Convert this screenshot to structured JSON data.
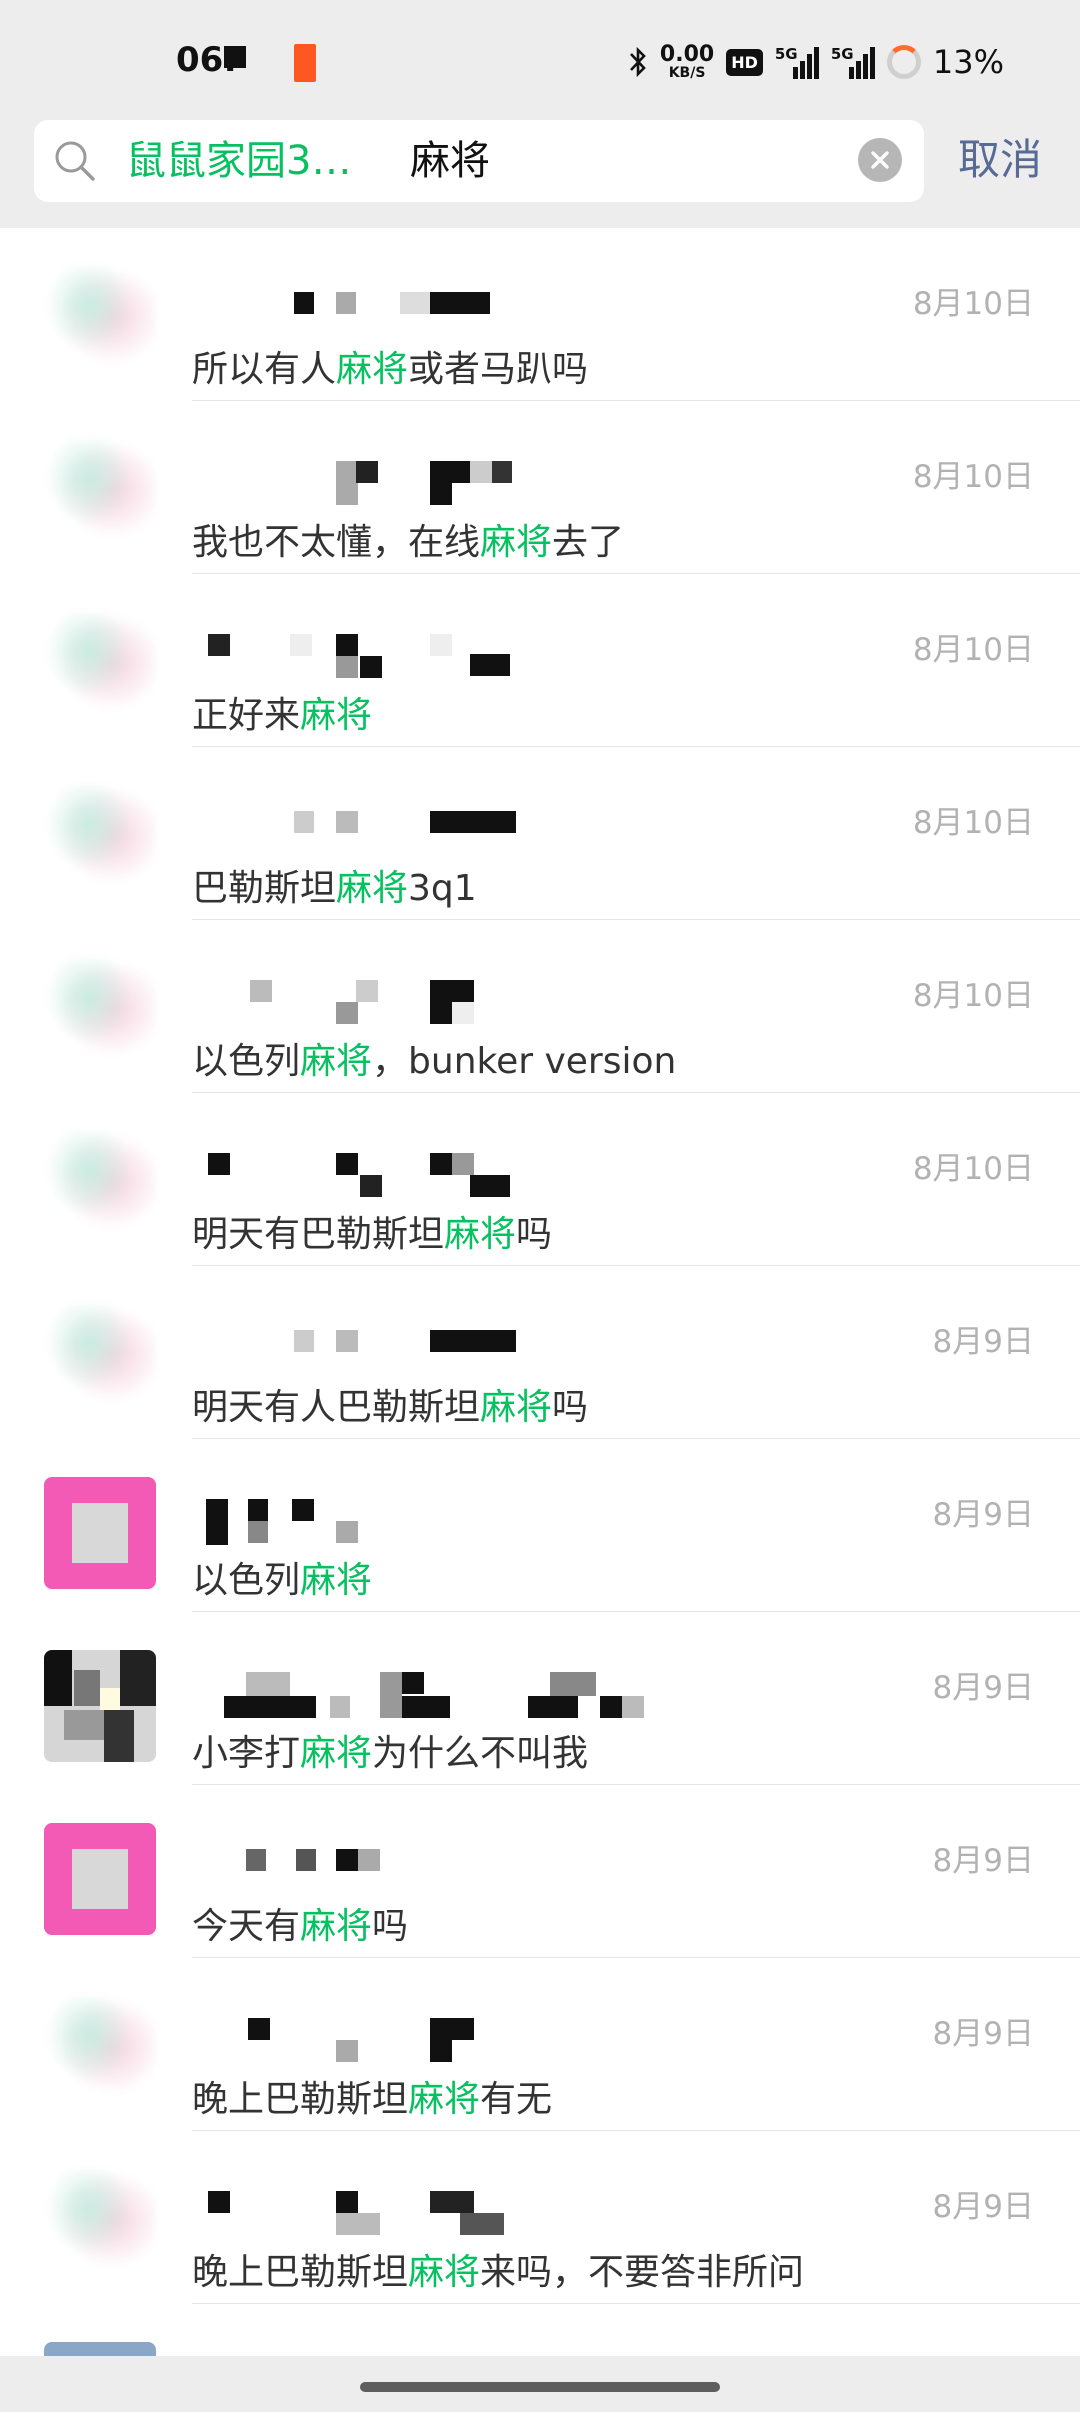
{
  "status_bar": {
    "time": "06:",
    "net_speed_value": "0.00",
    "net_speed_unit": "KB/S",
    "hd_badge": "HD",
    "sim1_label": "5G",
    "sim2_label": "5G",
    "battery_percent": "13%",
    "notification_color": "#ff5722"
  },
  "search": {
    "scope_chip": "鼠鼠家园3…",
    "query": "麻将",
    "cancel_label": "取消",
    "accent_color": "#07c160",
    "icons": [
      "search-icon",
      "clear-icon"
    ]
  },
  "results": [
    {
      "date": "8月10日",
      "before": "所以有人",
      "keyword": "麻将",
      "after": "或者马趴吗"
    },
    {
      "date": "8月10日",
      "before": "我也不太懂，在线",
      "keyword": "麻将",
      "after": "去了"
    },
    {
      "date": "8月10日",
      "before": "正好来",
      "keyword": "麻将",
      "after": ""
    },
    {
      "date": "8月10日",
      "before": "巴勒斯坦",
      "keyword": "麻将",
      "after": "3q1"
    },
    {
      "date": "8月10日",
      "before": "以色列",
      "keyword": "麻将",
      "after": "，bunker version"
    },
    {
      "date": "8月10日",
      "before": "明天有巴勒斯坦",
      "keyword": "麻将",
      "after": "吗"
    },
    {
      "date": "8月9日",
      "before": "明天有人巴勒斯坦",
      "keyword": "麻将",
      "after": "吗"
    },
    {
      "date": "8月9日",
      "before": "以色列",
      "keyword": "麻将",
      "after": ""
    },
    {
      "date": "8月9日",
      "before": "小李打",
      "keyword": "麻将",
      "after": "为什么不叫我"
    },
    {
      "date": "8月9日",
      "before": "今天有",
      "keyword": "麻将",
      "after": "吗"
    },
    {
      "date": "8月9日",
      "before": "晚上巴勒斯坦",
      "keyword": "麻将",
      "after": "有无"
    },
    {
      "date": "8月9日",
      "before": "晚上巴勒斯坦",
      "keyword": "麻将",
      "after": "来吗，不要答非所问"
    }
  ]
}
